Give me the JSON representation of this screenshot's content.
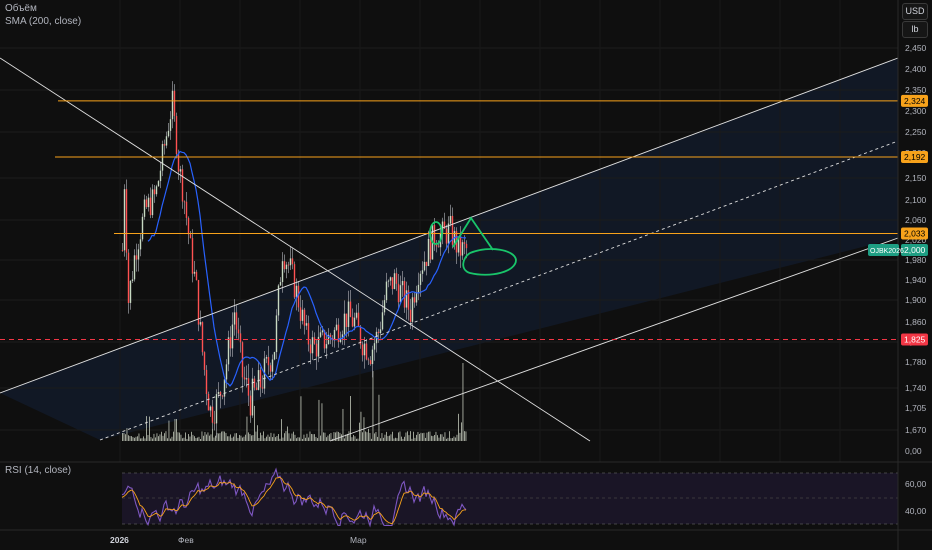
{
  "legend": {
    "volume": "Объём",
    "sma": "SMA (200, close)",
    "rsi": "RSI (14, close)"
  },
  "units": {
    "currency": "USD",
    "unit": "lb"
  },
  "chart_data": {
    "type": "candlestick",
    "price_axis": {
      "ticks": [
        "2,450",
        "2,400",
        "2,350",
        "2,300",
        "2,250",
        "2,200",
        "2,150",
        "2,100",
        "2,060",
        "2,020",
        "1,980",
        "1,940",
        "1,900",
        "1,860",
        "1,820",
        "1,780",
        "1,740",
        "1,705",
        "1,670",
        "0,00"
      ],
      "range": [
        1650,
        2475
      ]
    },
    "time_axis": {
      "labels": [
        "2026",
        "Фев",
        "Мар"
      ]
    },
    "price_tags": [
      {
        "label": "2,324",
        "value": 2324,
        "color": "#f7a21b",
        "text_color": "#000000"
      },
      {
        "label": "2,192",
        "value": 2192,
        "color": "#f7a21b",
        "text_color": "#000000"
      },
      {
        "label": "2,033",
        "value": 2033,
        "color": "#f7a21b",
        "text_color": "#000000"
      },
      {
        "label": "2,000",
        "value": 2000,
        "color": "#1e9e83",
        "text_color": "#ffffff"
      },
      {
        "label": "1,825",
        "value": 1825,
        "color": "#f23645",
        "text_color": "#ffffff"
      }
    ],
    "symbol_tag": "OJBK2026",
    "horizontal_levels": [
      {
        "value": 2324,
        "color": "#f7a21b",
        "style": "solid"
      },
      {
        "value": 2192,
        "color": "#f7a21b",
        "style": "solid"
      },
      {
        "value": 2033,
        "color": "#f7a21b",
        "style": "solid"
      },
      {
        "value": 1825,
        "color": "#f23645",
        "style": "dashed"
      }
    ],
    "candle_colors": {
      "up": "#c7d9c2",
      "down": "#ff5252",
      "wick": "#9ea0a6"
    },
    "sma_color": "#2962ff",
    "rsi_axis": {
      "ticks": [
        "60,00",
        "40,00"
      ],
      "upper": 70,
      "lower": 30
    },
    "rsi_color": "#7e57c2",
    "rsi_ma_color": "#f7a21b",
    "annotation_color": "#19c56a"
  }
}
